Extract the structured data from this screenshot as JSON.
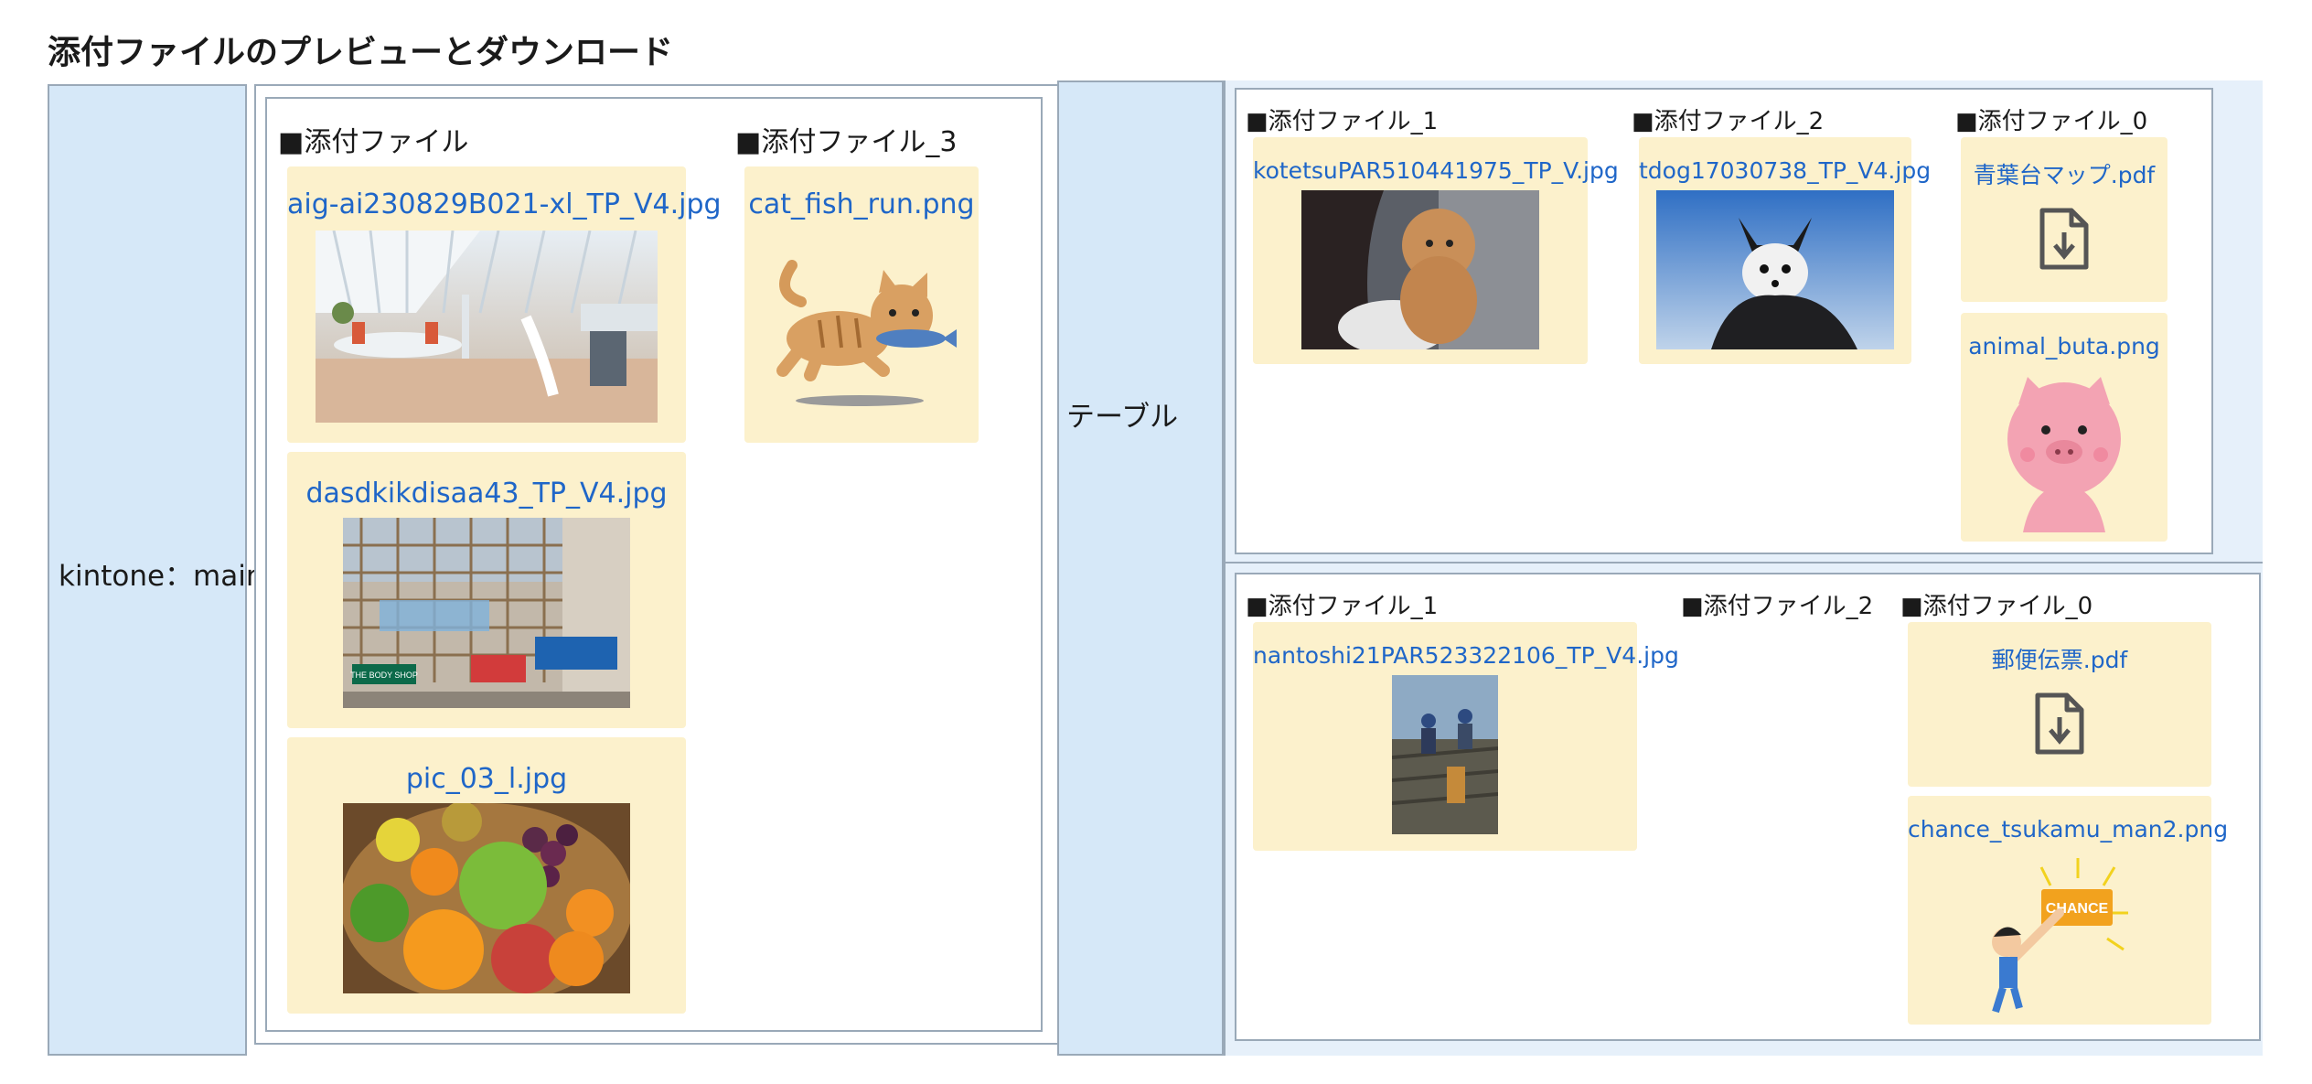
{
  "page_title": "添付ファイルのプレビューとダウンロード",
  "main_label": "kintone：main",
  "table_label": "テーブル",
  "main_fields": {
    "field1_label": "■添付ファイル",
    "field3_label": "■添付ファイル_3",
    "field1_files": [
      "aig-ai230829B021-xl_TP_V4.jpg",
      "dasdkikdisaa43_TP_V4.jpg",
      "pic_03_l.jpg"
    ],
    "field3_files": [
      "cat_fish_run.png"
    ]
  },
  "table_rows": [
    {
      "col1_label": "■添付ファイル_1",
      "col2_label": "■添付ファイル_2",
      "col0_label": "■添付ファイル_0",
      "col1_files": [
        "kotetsuPAR510441975_TP_V.jpg"
      ],
      "col2_files": [
        "tdog17030738_TP_V4.jpg"
      ],
      "col0_files": [
        "青葉台マップ.pdf",
        "animal_buta.png"
      ]
    },
    {
      "col1_label": "■添付ファイル_1",
      "col2_label": "■添付ファイル_2",
      "col0_label": "■添付ファイル_0",
      "col1_files": [
        "nantoshi21PAR523322106_TP_V4.jpg"
      ],
      "col2_files": [],
      "col0_files": [
        "郵便伝票.pdf",
        "chance_tsukamu_man2.png"
      ]
    }
  ],
  "chance_text": "CHANCE",
  "shop_sign": "THE BODY SHOP",
  "icons": [
    "download-file-icon"
  ],
  "colors": {
    "link": "#1f66c8",
    "card_bg": "#fcf1cc",
    "label_bg": "#d6e8f8"
  }
}
